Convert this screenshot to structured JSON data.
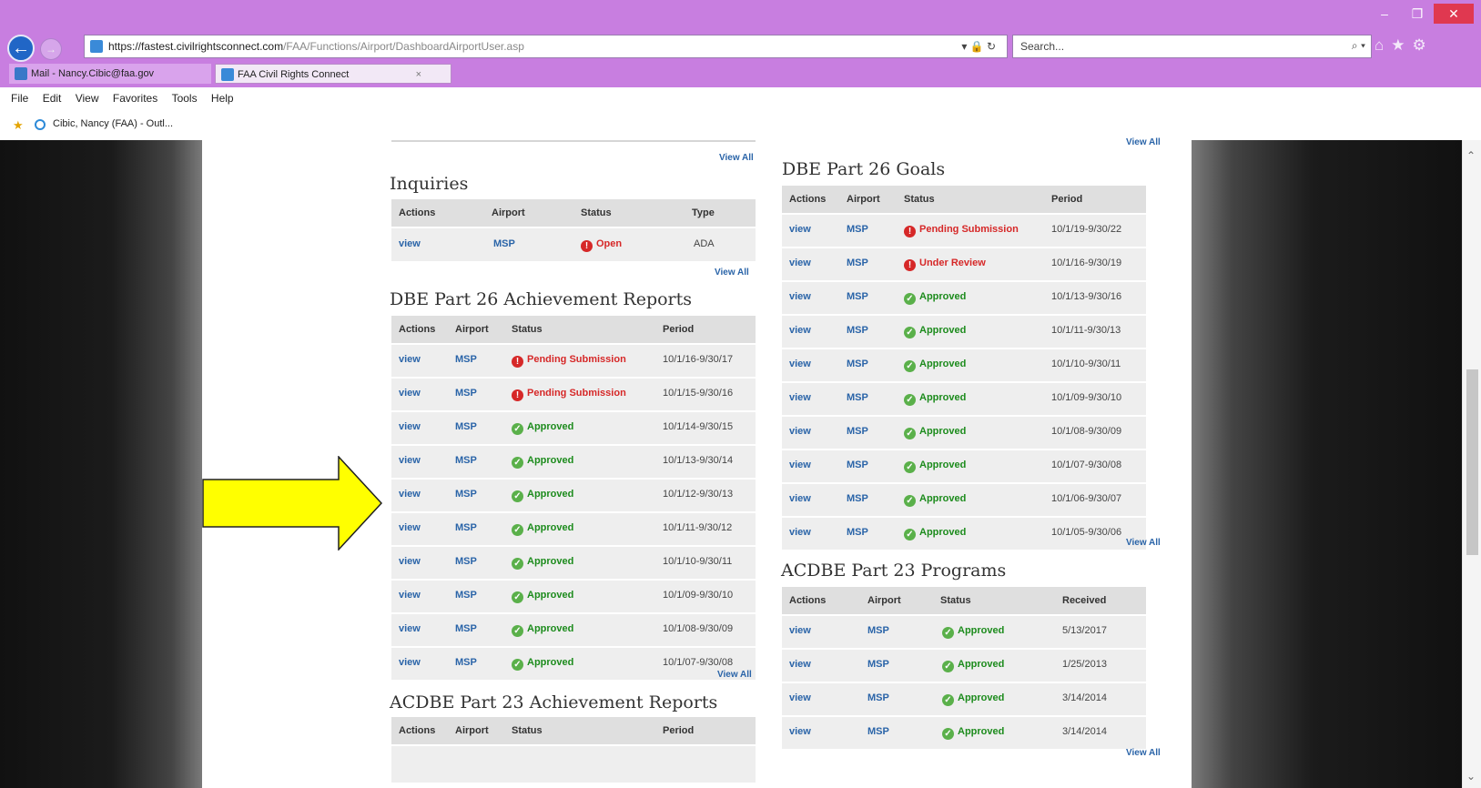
{
  "browser": {
    "url_prefix": "https://",
    "url_host": "fastest.civilrightsconnect.com",
    "url_path": "/FAA/Functions/Airport/DashboardAirportUser.asp",
    "search_placeholder": "Search...",
    "tabs": [
      {
        "label": "Mail - Nancy.Cibic@faa.gov"
      },
      {
        "label": "FAA Civil Rights Connect"
      }
    ],
    "menu": [
      "File",
      "Edit",
      "View",
      "Favorites",
      "Tools",
      "Help"
    ],
    "favorites": [
      {
        "label": "Cibic, Nancy (FAA) - Outl..."
      }
    ]
  },
  "page": {
    "view_all_label": "View All",
    "inquiries": {
      "title": "Inquiries",
      "headers": [
        "Actions",
        "Airport",
        "Status",
        "Type"
      ],
      "rows": [
        {
          "action": "view",
          "airport": "MSP",
          "status": "Open",
          "status_type": "pending",
          "type": "ADA"
        }
      ]
    },
    "dbe_achievement": {
      "title": "DBE Part 26 Achievement Reports",
      "headers": [
        "Actions",
        "Airport",
        "Status",
        "Period"
      ],
      "rows": [
        {
          "action": "view",
          "airport": "MSP",
          "status": "Pending Submission",
          "status_type": "pending",
          "period": "10/1/16-9/30/17"
        },
        {
          "action": "view",
          "airport": "MSP",
          "status": "Pending Submission",
          "status_type": "pending",
          "period": "10/1/15-9/30/16"
        },
        {
          "action": "view",
          "airport": "MSP",
          "status": "Approved",
          "status_type": "approved",
          "period": "10/1/14-9/30/15"
        },
        {
          "action": "view",
          "airport": "MSP",
          "status": "Approved",
          "status_type": "approved",
          "period": "10/1/13-9/30/14"
        },
        {
          "action": "view",
          "airport": "MSP",
          "status": "Approved",
          "status_type": "approved",
          "period": "10/1/12-9/30/13"
        },
        {
          "action": "view",
          "airport": "MSP",
          "status": "Approved",
          "status_type": "approved",
          "period": "10/1/11-9/30/12"
        },
        {
          "action": "view",
          "airport": "MSP",
          "status": "Approved",
          "status_type": "approved",
          "period": "10/1/10-9/30/11"
        },
        {
          "action": "view",
          "airport": "MSP",
          "status": "Approved",
          "status_type": "approved",
          "period": "10/1/09-9/30/10"
        },
        {
          "action": "view",
          "airport": "MSP",
          "status": "Approved",
          "status_type": "approved",
          "period": "10/1/08-9/30/09"
        },
        {
          "action": "view",
          "airport": "MSP",
          "status": "Approved",
          "status_type": "approved",
          "period": "10/1/07-9/30/08"
        }
      ]
    },
    "acdbe_achievement": {
      "title": "ACDBE Part 23 Achievement Reports",
      "headers": [
        "Actions",
        "Airport",
        "Status",
        "Period"
      ]
    },
    "dbe_goals": {
      "title": "DBE Part 26 Goals",
      "headers": [
        "Actions",
        "Airport",
        "Status",
        "Period"
      ],
      "rows": [
        {
          "action": "view",
          "airport": "MSP",
          "status": "Pending Submission",
          "status_type": "pending",
          "period": "10/1/19-9/30/22"
        },
        {
          "action": "view",
          "airport": "MSP",
          "status": "Under Review",
          "status_type": "pending",
          "period": "10/1/16-9/30/19"
        },
        {
          "action": "view",
          "airport": "MSP",
          "status": "Approved",
          "status_type": "approved",
          "period": "10/1/13-9/30/16"
        },
        {
          "action": "view",
          "airport": "MSP",
          "status": "Approved",
          "status_type": "approved",
          "period": "10/1/11-9/30/13"
        },
        {
          "action": "view",
          "airport": "MSP",
          "status": "Approved",
          "status_type": "approved",
          "period": "10/1/10-9/30/11"
        },
        {
          "action": "view",
          "airport": "MSP",
          "status": "Approved",
          "status_type": "approved",
          "period": "10/1/09-9/30/10"
        },
        {
          "action": "view",
          "airport": "MSP",
          "status": "Approved",
          "status_type": "approved",
          "period": "10/1/08-9/30/09"
        },
        {
          "action": "view",
          "airport": "MSP",
          "status": "Approved",
          "status_type": "approved",
          "period": "10/1/07-9/30/08"
        },
        {
          "action": "view",
          "airport": "MSP",
          "status": "Approved",
          "status_type": "approved",
          "period": "10/1/06-9/30/07"
        },
        {
          "action": "view",
          "airport": "MSP",
          "status": "Approved",
          "status_type": "approved",
          "period": "10/1/05-9/30/06"
        }
      ]
    },
    "acdbe_programs": {
      "title": "ACDBE Part 23 Programs",
      "headers": [
        "Actions",
        "Airport",
        "Status",
        "Received"
      ],
      "rows": [
        {
          "action": "view",
          "airport": "MSP",
          "status": "Approved",
          "status_type": "approved",
          "received": "5/13/2017"
        },
        {
          "action": "view",
          "airport": "MSP",
          "status": "Approved",
          "status_type": "approved",
          "received": "1/25/2013"
        },
        {
          "action": "view",
          "airport": "MSP",
          "status": "Approved",
          "status_type": "approved",
          "received": "3/14/2014"
        },
        {
          "action": "view",
          "airport": "MSP",
          "status": "Approved",
          "status_type": "approved",
          "received": "3/14/2014"
        }
      ]
    }
  },
  "colors": {
    "browser_chrome": "#c87ee0",
    "highlight_arrow": "#ffff00",
    "pending": "#d62828",
    "approved": "#1c8b1c",
    "link": "#2a64a8"
  }
}
